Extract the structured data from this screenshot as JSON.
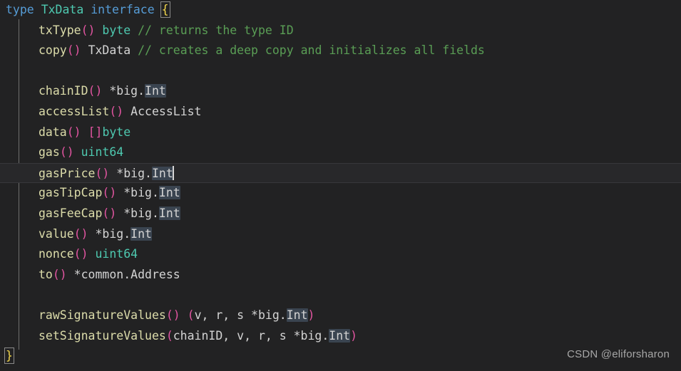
{
  "editor": {
    "language": "go",
    "background_color": "#222223",
    "current_line_color": "#28282a",
    "occurrence_highlight_color": "#3a4450",
    "caret_color": "#d6d6d6",
    "indent_guide_color": "#6e6e6e",
    "colors": {
      "keyword": "#569cd6",
      "type": "#4ec9b0",
      "function": "#dcdcaa",
      "punctuation": "#e255a1",
      "plain": "#d4d4d4",
      "comment": "#5a9e55",
      "brace": "#f3d74c"
    }
  },
  "code": {
    "l1": {
      "kw_type": "type",
      "name": "TxData",
      "kw_interface": "interface",
      "brace": "{"
    },
    "l2": {
      "fn": "txType",
      "parens": "()",
      "sp": " ",
      "type": "byte",
      "comment": "// returns the type ID"
    },
    "l3": {
      "fn": "copy",
      "parens": "()",
      "sp": " ",
      "ret": "TxData",
      "comment": "// creates a deep copy and initializes all fields"
    },
    "l5": {
      "fn": "chainID",
      "parens": "()",
      "pre": " *big.",
      "occ": "Int"
    },
    "l6": {
      "fn": "accessList",
      "parens": "()",
      "pre": " ",
      "ret": "AccessList"
    },
    "l7": {
      "fn": "data",
      "parens": "()",
      "sp": " ",
      "brackets": "[]",
      "type": "byte"
    },
    "l8": {
      "fn": "gas",
      "parens": "()",
      "sp": " ",
      "type": "uint64"
    },
    "l9": {
      "fn": "gasPrice",
      "parens": "()",
      "pre": " *big.",
      "occ": "Int"
    },
    "l10": {
      "fn": "gasTipCap",
      "parens": "()",
      "pre": " *big.",
      "occ": "Int"
    },
    "l11": {
      "fn": "gasFeeCap",
      "parens": "()",
      "pre": " *big.",
      "occ": "Int"
    },
    "l12": {
      "fn": "value",
      "parens": "()",
      "pre": " *big.",
      "occ": "Int"
    },
    "l13": {
      "fn": "nonce",
      "parens": "()",
      "sp": " ",
      "type": "uint64"
    },
    "l14": {
      "fn": "to",
      "parens": "()",
      "pre": " *common.Address"
    },
    "l16": {
      "fn": "rawSignatureValues",
      "parens": "()",
      "open": " (",
      "params": "v, r, s *big.",
      "occ": "Int",
      "close": ")"
    },
    "l17": {
      "fn": "setSignatureValues",
      "open": "(",
      "params": "chainID, v, r, s *big.",
      "occ": "Int",
      "close": ")"
    },
    "l18": {
      "brace": "}"
    }
  },
  "watermark": {
    "text": "CSDN @eliforsharon"
  }
}
